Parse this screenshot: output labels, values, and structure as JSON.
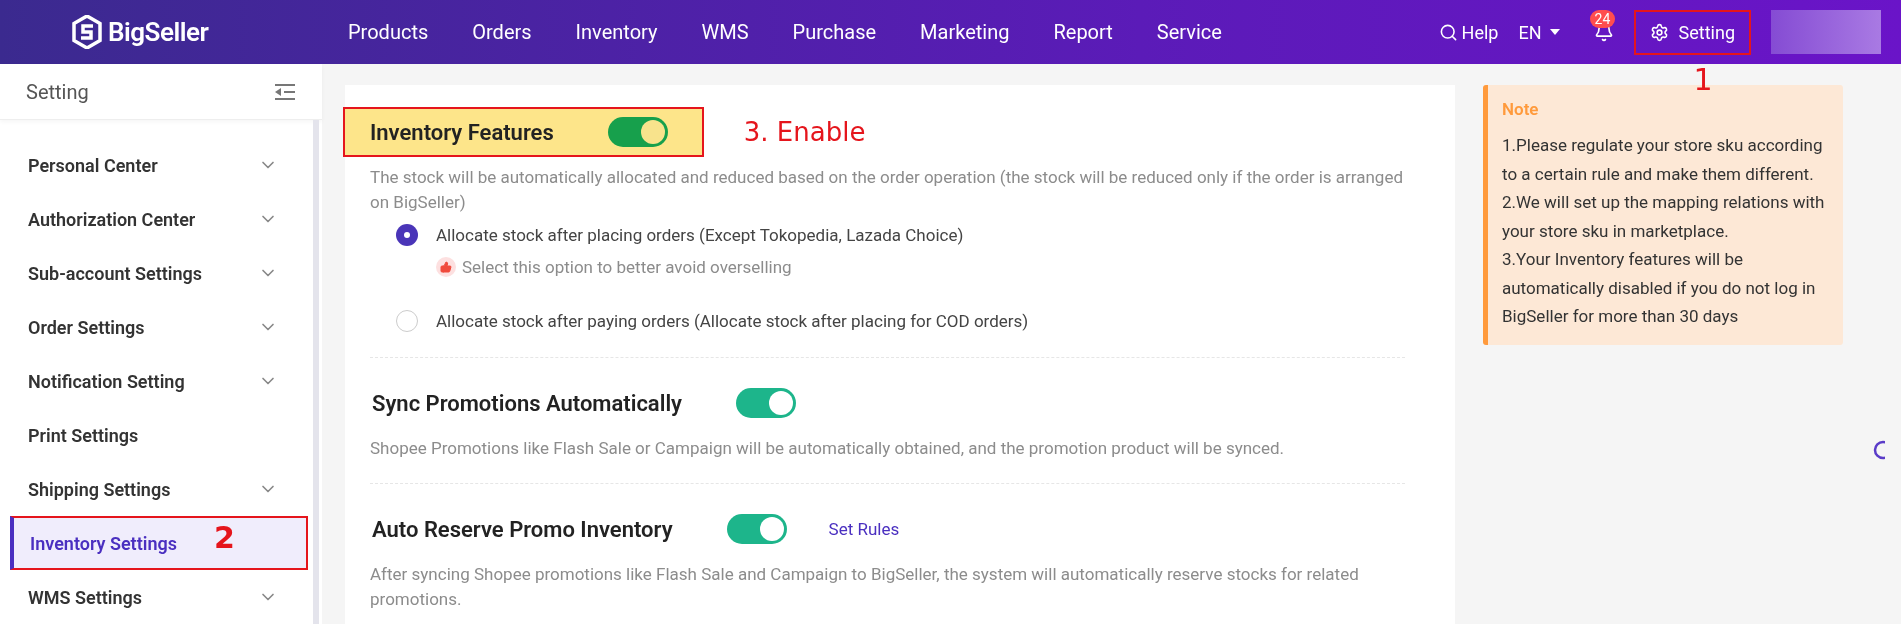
{
  "header": {
    "logo": "BigSeller",
    "nav": [
      "Products",
      "Orders",
      "Inventory",
      "WMS",
      "Purchase",
      "Marketing",
      "Report",
      "Service"
    ],
    "help": "Help",
    "language": "EN",
    "notification_count": "24",
    "setting": {
      "label": "Setting",
      "highlighted": true,
      "callout": "1"
    }
  },
  "sidebar": {
    "title": "Setting",
    "items": [
      {
        "label": "Personal Center",
        "expandable": true,
        "selected": false
      },
      {
        "label": "Authorization Center",
        "expandable": true,
        "selected": false
      },
      {
        "label": "Sub-account Settings",
        "expandable": true,
        "selected": false
      },
      {
        "label": "Order Settings",
        "expandable": true,
        "selected": false
      },
      {
        "label": "Notification Setting",
        "expandable": true,
        "selected": false
      },
      {
        "label": "Print Settings",
        "expandable": false,
        "selected": false
      },
      {
        "label": "Shipping Settings",
        "expandable": true,
        "selected": false
      },
      {
        "label": "Inventory Settings",
        "expandable": false,
        "selected": true,
        "highlighted": true,
        "callout": "2"
      },
      {
        "label": "WMS Settings",
        "expandable": true,
        "selected": false
      }
    ]
  },
  "sections": [
    {
      "title": "Inventory Features",
      "on": true,
      "highlighted": true,
      "callout": "3. Enable",
      "description": "The stock will be automatically allocated and reduced based on the order operation (the stock will be reduced only if the order is arranged on BigSeller)",
      "options": [
        {
          "label": "Allocate stock after placing orders (Except Tokopedia, Lazada Choice)",
          "selected": true,
          "hint": "Select this option to better avoid overselling"
        },
        {
          "label": "Allocate stock after paying orders (Allocate stock after placing for COD orders)",
          "selected": false
        }
      ]
    },
    {
      "title": "Sync Promotions Automatically",
      "on": true,
      "description": "Shopee Promotions like Flash Sale or Campaign will be automatically obtained, and the promotion product will be synced."
    },
    {
      "title": "Auto Reserve Promo Inventory",
      "on": true,
      "link": "Set Rules",
      "description": "After syncing Shopee promotions like Flash Sale and Campaign to BigSeller, the system will automatically reserve stocks for related promotions."
    }
  ],
  "note": {
    "title": "Note",
    "lines": [
      "1.Please regulate your store sku according to a certain rule and make them different.",
      "2.We will set up the mapping relations with your store sku in marketplace.",
      "3.Your Inventory features will be automatically disabled if you do not log in BigSeller for more than 30 days"
    ]
  }
}
